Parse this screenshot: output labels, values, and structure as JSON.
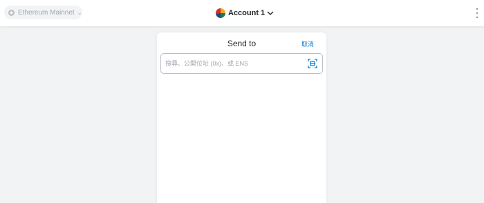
{
  "header": {
    "network": {
      "label": "Ethereum Mainnet",
      "icon": "ethereum-icon",
      "chevron": "⌄"
    },
    "account": {
      "name": "Account 1",
      "chevron": "⌄",
      "avatar": "account-avatar-icon"
    },
    "menu_icon": "kebab-menu-icon"
  },
  "send": {
    "title": "Send to",
    "cancel_label": "取消",
    "search": {
      "placeholder": "搜尋、公開位址 (0x)、或 ENS",
      "value": "",
      "qr_icon": "qr-scan-icon"
    }
  },
  "colors": {
    "accent": "#037dd6",
    "background": "#f2f3f4",
    "panel": "#ffffff"
  }
}
